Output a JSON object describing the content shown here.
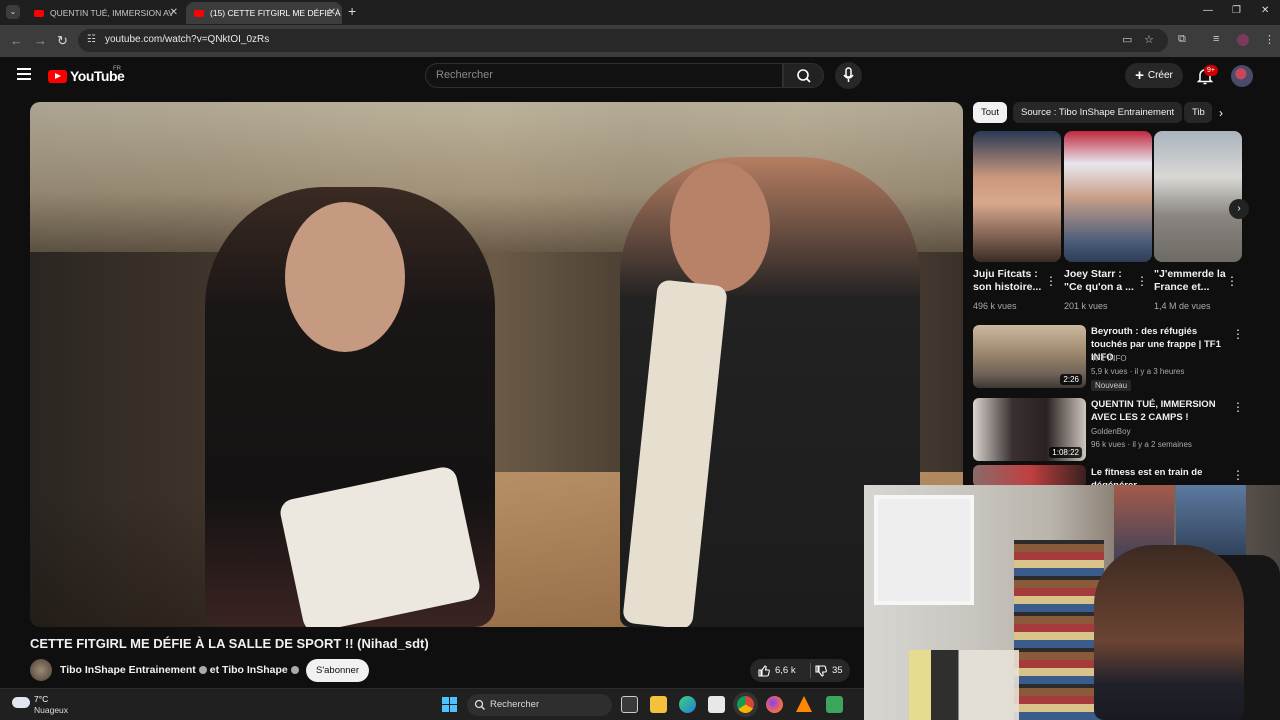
{
  "browser": {
    "tabs": [
      {
        "title": "QUENTIN TUÉ, IMMERSION AV",
        "active": false
      },
      {
        "title": "(15) CETTE FITGIRL ME DÉFIE À",
        "active": true
      }
    ],
    "url": "youtube.com/watch?v=QNktOI_0zRs",
    "new_tab_icon": "plus-icon",
    "window_controls": [
      "minimize-icon",
      "restore-icon",
      "close-icon"
    ]
  },
  "youtube": {
    "logo_text": "YouTube",
    "country_code": "FR",
    "search_placeholder": "Rechercher",
    "create_label": "Créer",
    "notification_count": "9+"
  },
  "video": {
    "title": "CETTE FITGIRL ME DÉFIE À LA SALLE DE SPORT !! (Nihad_sdt)",
    "channel": "Tibo InShape Entrainement",
    "channel_joiner": "et Tibo InShape",
    "subscribe_label": "S'abonner",
    "likes": "6,6 k",
    "dislikes": "35"
  },
  "sidebar": {
    "chips": [
      "Tout",
      "Source : Tibo InShape Entrainement",
      "Tib"
    ],
    "shorts": [
      {
        "title": "Juju Fitcats : son histoire...",
        "views": "496 k vues"
      },
      {
        "title": "Joey Starr : \"Ce qu'on a ...",
        "views": "201 k vues"
      },
      {
        "title": "\"J'emmerde la France et...",
        "views": "1,4 M de vues"
      }
    ],
    "recommendations": [
      {
        "title": "Beyrouth : des réfugiés touchés par une frappe | TF1 INFO",
        "channel": "TF1 INFO",
        "meta": "5,9 k vues · il y a 3 heures",
        "badge": "Nouveau",
        "duration": "2:26"
      },
      {
        "title": "QUENTIN TUÉ, IMMERSION AVEC LES 2 CAMPS !",
        "channel": "GoldenBoy",
        "meta": "96 k vues · il y a 2 semaines",
        "duration": "1:08:22"
      },
      {
        "title": "Le fitness est en train de dégénérer",
        "channel": "",
        "meta": ""
      }
    ]
  },
  "taskbar": {
    "temperature": "7°C",
    "weather": "Nuageux",
    "search_label": "Rechercher",
    "icons": [
      "task-view-icon",
      "file-explorer-icon",
      "edge-icon",
      "store-icon",
      "chrome-icon",
      "firefox-icon",
      "vlc-icon",
      "app-icon"
    ]
  },
  "colors": {
    "youtube_red": "#ff0000",
    "background": "#0f0f0f",
    "windows_accent": "#4cc2ff"
  }
}
